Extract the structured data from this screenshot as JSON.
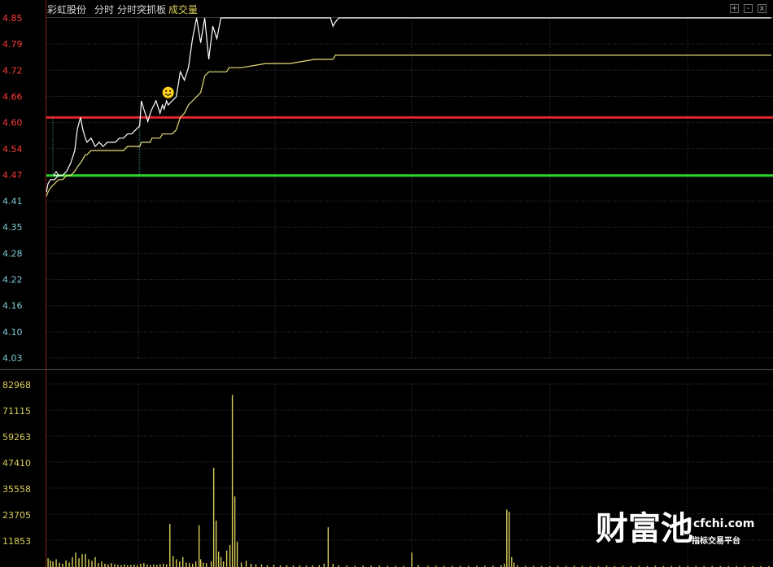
{
  "header": {
    "stock_name": "彩虹股份",
    "tab_intraday": "分时",
    "tab_indicator": "分时突抓板",
    "volume_label": "成交量"
  },
  "window_buttons": [
    "+",
    "-",
    "x"
  ],
  "watermark": {
    "brand": "财富池",
    "domain": "cfchi.com",
    "tagline": "指标交易平台"
  },
  "colors": {
    "background": "#000000",
    "price_line": "#ffffff",
    "avg_line": "#e8e07a",
    "limit_up_line": "#e0262a",
    "prev_close_line": "#2bd62b",
    "up_label": "#ff3b3b",
    "down_label": "#7fc9d6",
    "volume_label": "#d9cf5a",
    "grid": "#3a3a3a",
    "smiley": "#ffd21f"
  },
  "chart_data": [
    {
      "type": "line",
      "panel": "price",
      "ylim": [
        4.03,
        4.85
      ],
      "y_ticks": [
        "4.85",
        "4.79",
        "4.72",
        "4.66",
        "4.60",
        "4.54",
        "4.47",
        "4.41",
        "4.35",
        "4.28",
        "4.22",
        "4.16",
        "4.10",
        "4.03"
      ],
      "x": [
        0,
        2,
        5,
        10,
        15,
        20,
        25,
        30,
        35,
        38,
        42,
        45,
        48,
        50,
        55,
        60,
        65,
        70,
        75,
        80,
        85,
        90,
        95,
        100,
        105,
        110,
        115,
        117,
        120,
        125,
        128,
        130,
        135,
        140,
        143,
        145,
        148,
        150,
        155,
        160,
        165,
        170,
        175,
        180,
        185,
        190,
        195,
        200,
        205,
        210,
        215,
        220,
        222,
        225,
        228,
        231,
        240,
        270,
        300,
        330,
        340,
        350,
        353,
        356,
        360,
        380,
        400,
        420,
        440,
        460,
        480,
        500,
        520,
        540,
        560,
        580,
        600,
        620,
        640,
        660,
        680,
        700,
        720,
        740,
        760,
        780,
        800,
        820,
        840,
        860,
        880,
        893
      ],
      "series": [
        {
          "values": [
            4.43,
            4.45,
            4.46,
            4.46,
            4.47,
            4.47,
            4.48,
            4.5,
            4.53,
            4.58,
            4.61,
            4.58,
            4.56,
            4.55,
            4.56,
            4.54,
            4.55,
            4.54,
            4.55,
            4.55,
            4.55,
            4.56,
            4.56,
            4.57,
            4.57,
            4.58,
            4.59,
            4.65,
            4.63,
            4.6,
            4.62,
            4.63,
            4.65,
            4.62,
            4.64,
            4.63,
            4.65,
            4.64,
            4.65,
            4.66,
            4.72,
            4.7,
            4.73,
            4.8,
            4.85,
            4.79,
            4.85,
            4.75,
            4.83,
            4.8,
            4.85,
            4.85,
            4.85,
            4.85,
            4.85,
            4.85,
            4.85,
            4.85,
            4.85,
            4.85,
            4.85,
            4.85,
            4.83,
            4.84,
            4.85,
            4.85,
            4.85,
            4.85,
            4.85,
            4.85,
            4.85,
            4.85,
            4.85,
            4.85,
            4.85,
            4.85,
            4.85,
            4.85,
            4.85,
            4.85,
            4.85,
            4.85,
            4.85,
            4.85,
            4.85,
            4.85,
            4.85,
            4.85,
            4.85,
            4.85,
            4.85,
            4.85
          ]
        },
        {
          "values": [
            4.42,
            4.43,
            4.44,
            4.45,
            4.46,
            4.46,
            4.47,
            4.47,
            4.48,
            4.49,
            4.5,
            4.51,
            4.52,
            4.52,
            4.53,
            4.53,
            4.53,
            4.53,
            4.53,
            4.53,
            4.53,
            4.53,
            4.53,
            4.54,
            4.54,
            4.54,
            4.54,
            4.55,
            4.55,
            4.55,
            4.55,
            4.56,
            4.56,
            4.56,
            4.57,
            4.57,
            4.57,
            4.57,
            4.57,
            4.58,
            4.61,
            4.62,
            4.64,
            4.65,
            4.66,
            4.67,
            4.71,
            4.72,
            4.72,
            4.72,
            4.72,
            4.72,
            4.72,
            4.73,
            4.73,
            4.73,
            4.73,
            4.74,
            4.74,
            4.75,
            4.75,
            4.75,
            4.75,
            4.76,
            4.76,
            4.76,
            4.76,
            4.76,
            4.76,
            4.76,
            4.76,
            4.76,
            4.76,
            4.76,
            4.76,
            4.76,
            4.76,
            4.76,
            4.76,
            4.76,
            4.76,
            4.76,
            4.76,
            4.76,
            4.76,
            4.76,
            4.76,
            4.76,
            4.76,
            4.76,
            4.76,
            4.76
          ]
        }
      ],
      "reference_lines": [
        {
          "role": "limit-up",
          "value": 4.61
        },
        {
          "role": "prev-close",
          "value": 4.47
        }
      ],
      "event_marks": [
        {
          "kind": "arrow",
          "x": 12,
          "y": 4.47
        },
        {
          "kind": "smiley",
          "x": 150,
          "y": 4.67
        },
        {
          "kind": "dotted-vline",
          "x": 8
        },
        {
          "kind": "dotted-vline",
          "x": 115
        }
      ]
    },
    {
      "type": "bar",
      "panel": "volume",
      "title": "成交量",
      "ylim": [
        0,
        82968
      ],
      "y_ticks": [
        "82968",
        "71115",
        "59263",
        "47410",
        "35558",
        "23705",
        "11853"
      ],
      "bars": [
        [
          2,
          4000
        ],
        [
          5,
          3000
        ],
        [
          8,
          2500
        ],
        [
          12,
          3500
        ],
        [
          16,
          2000
        ],
        [
          20,
          1500
        ],
        [
          24,
          3000
        ],
        [
          28,
          2000
        ],
        [
          32,
          4500
        ],
        [
          36,
          6500
        ],
        [
          40,
          4000
        ],
        [
          44,
          5800
        ],
        [
          48,
          6000
        ],
        [
          52,
          3500
        ],
        [
          56,
          2800
        ],
        [
          60,
          4500
        ],
        [
          64,
          1800
        ],
        [
          68,
          2500
        ],
        [
          72,
          1500
        ],
        [
          76,
          1200
        ],
        [
          80,
          1800
        ],
        [
          84,
          1300
        ],
        [
          88,
          1000
        ],
        [
          92,
          900
        ],
        [
          96,
          1200
        ],
        [
          100,
          800
        ],
        [
          104,
          1000
        ],
        [
          108,
          1100
        ],
        [
          112,
          900
        ],
        [
          116,
          1500
        ],
        [
          120,
          1800
        ],
        [
          124,
          1200
        ],
        [
          128,
          900
        ],
        [
          132,
          1100
        ],
        [
          136,
          1000
        ],
        [
          140,
          1300
        ],
        [
          144,
          1500
        ],
        [
          148,
          1200
        ],
        [
          152,
          19500
        ],
        [
          156,
          5000
        ],
        [
          160,
          3500
        ],
        [
          164,
          2500
        ],
        [
          168,
          4500
        ],
        [
          172,
          2000
        ],
        [
          176,
          1800
        ],
        [
          180,
          1500
        ],
        [
          184,
          2500
        ],
        [
          188,
          19000
        ],
        [
          190,
          3500
        ],
        [
          193,
          2000
        ],
        [
          197,
          1800
        ],
        [
          203,
          2500
        ],
        [
          206,
          45000
        ],
        [
          209,
          21000
        ],
        [
          212,
          7000
        ],
        [
          215,
          4500
        ],
        [
          218,
          2500
        ],
        [
          222,
          7500
        ],
        [
          226,
          10000
        ],
        [
          229,
          78000
        ],
        [
          232,
          32000
        ],
        [
          235,
          11500
        ],
        [
          240,
          2000
        ],
        [
          246,
          2800
        ],
        [
          252,
          1500
        ],
        [
          258,
          1200
        ],
        [
          265,
          1200
        ],
        [
          272,
          800
        ],
        [
          280,
          1000
        ],
        [
          288,
          700
        ],
        [
          296,
          800
        ],
        [
          304,
          600
        ],
        [
          312,
          700
        ],
        [
          320,
          600
        ],
        [
          328,
          700
        ],
        [
          336,
          800
        ],
        [
          342,
          1500
        ],
        [
          347,
          18000
        ],
        [
          353,
          1500
        ],
        [
          360,
          800
        ],
        [
          370,
          600
        ],
        [
          380,
          500
        ],
        [
          390,
          600
        ],
        [
          400,
          500
        ],
        [
          410,
          600
        ],
        [
          420,
          500
        ],
        [
          430,
          500
        ],
        [
          440,
          500
        ],
        [
          450,
          6500
        ],
        [
          458,
          900
        ],
        [
          470,
          500
        ],
        [
          480,
          500
        ],
        [
          490,
          500
        ],
        [
          500,
          500
        ],
        [
          510,
          500
        ],
        [
          520,
          500
        ],
        [
          530,
          500
        ],
        [
          540,
          500
        ],
        [
          550,
          500
        ],
        [
          560,
          800
        ],
        [
          564,
          1500
        ],
        [
          567,
          26000
        ],
        [
          570,
          25000
        ],
        [
          573,
          4500
        ],
        [
          576,
          2000
        ],
        [
          580,
          800
        ],
        [
          590,
          500
        ],
        [
          600,
          500
        ],
        [
          610,
          400
        ],
        [
          620,
          400
        ],
        [
          630,
          500
        ],
        [
          640,
          500
        ],
        [
          650,
          600
        ],
        [
          660,
          500
        ],
        [
          670,
          400
        ],
        [
          680,
          400
        ],
        [
          690,
          500
        ],
        [
          700,
          400
        ],
        [
          710,
          500
        ],
        [
          720,
          400
        ],
        [
          730,
          500
        ],
        [
          740,
          400
        ],
        [
          750,
          500
        ],
        [
          760,
          400
        ],
        [
          770,
          400
        ],
        [
          780,
          500
        ],
        [
          790,
          400
        ],
        [
          800,
          500
        ],
        [
          810,
          400
        ],
        [
          820,
          400
        ],
        [
          830,
          400
        ],
        [
          840,
          400
        ],
        [
          850,
          400
        ],
        [
          860,
          400
        ],
        [
          870,
          400
        ],
        [
          880,
          400
        ],
        [
          890,
          400
        ]
      ]
    }
  ]
}
